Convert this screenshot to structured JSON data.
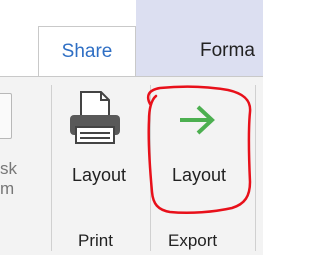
{
  "tabs": {
    "share_label": "Share",
    "format_label": "Forma"
  },
  "ribbon": {
    "partial_label_line1": "sk",
    "partial_label_line2": "m",
    "print_group": {
      "button_label": "Layout",
      "group_label": "Print",
      "icon": "printer-icon"
    },
    "export_group": {
      "button_label": "Layout",
      "group_label": "Export",
      "icon": "arrow-right-icon"
    }
  },
  "colors": {
    "tab_active_text": "#2f6fc4",
    "format_tab_bg": "#dcdff1",
    "ribbon_bg": "#f3f3f3",
    "arrow_green": "#4caf50",
    "annotation_red": "#e8101a"
  }
}
